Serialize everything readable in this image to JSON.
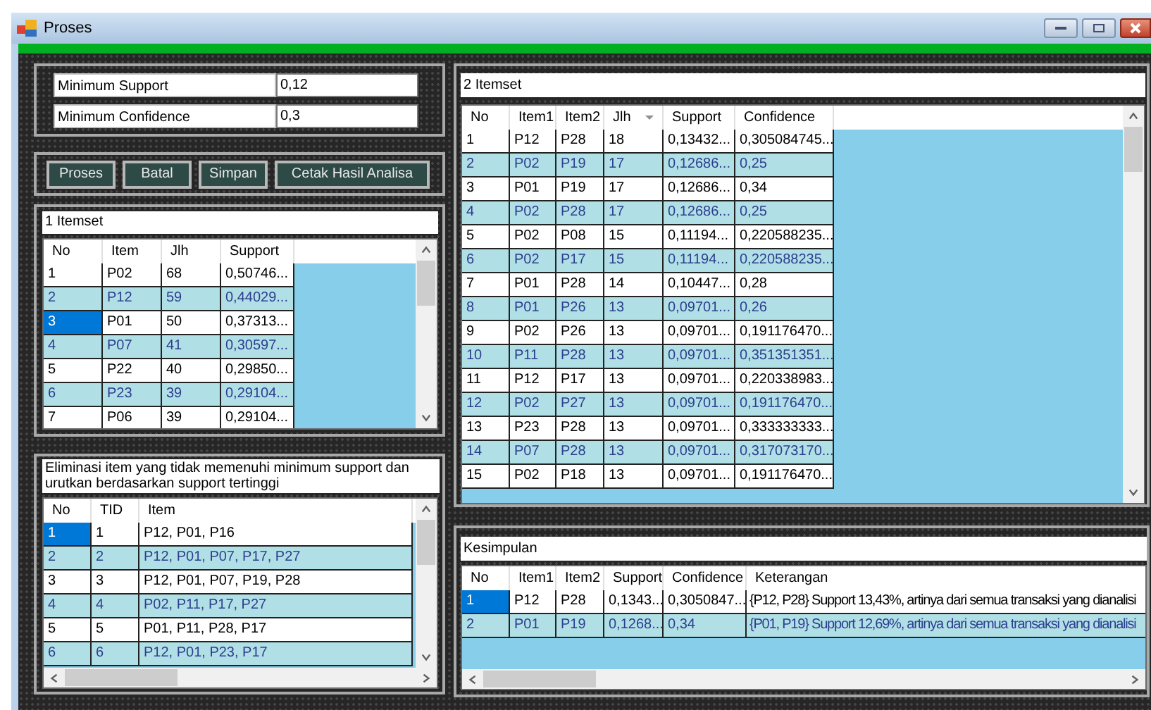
{
  "window": {
    "title": "Proses"
  },
  "parameters": [
    {
      "label": "Minimum Support",
      "value": "0,12"
    },
    {
      "label": "Minimum Confidence",
      "value": "0,3"
    }
  ],
  "buttons": [
    "Proses",
    "Batal",
    "Simpan",
    "Cetak Hasil Analisa"
  ],
  "itemset_1": {
    "title": "1 Itemset",
    "columns": [
      {
        "label": "No"
      },
      {
        "label": "Item"
      },
      {
        "label": "Jlh"
      },
      {
        "label": "Support"
      }
    ],
    "rows": [
      {
        "cells": [
          "1",
          "P02",
          "68",
          "0,50746..."
        ],
        "selected": false
      },
      {
        "cells": [
          "2",
          "P12",
          "59",
          "0,44029..."
        ],
        "selected": false
      },
      {
        "cells": [
          "3",
          "P01",
          "50",
          "0,37313..."
        ],
        "selected": true
      },
      {
        "cells": [
          "4",
          "P07",
          "41",
          "0,30597..."
        ],
        "selected": false
      },
      {
        "cells": [
          "5",
          "P22",
          "40",
          "0,29850..."
        ],
        "selected": false
      },
      {
        "cells": [
          "6",
          "P23",
          "39",
          "0,29104..."
        ],
        "selected": false
      },
      {
        "cells": [
          "7",
          "P06",
          "39",
          "0,29104..."
        ],
        "selected": false
      }
    ]
  },
  "elimination": {
    "title": "Eliminasi item yang tidak memenuhi minimum support dan urutkan berdasarkan support tertinggi",
    "columns": [
      {
        "label": "No"
      },
      {
        "label": "TID"
      },
      {
        "label": "Item"
      }
    ],
    "rows": [
      {
        "cells": [
          "1",
          "1",
          "P12, P01, P16"
        ],
        "selected": true
      },
      {
        "cells": [
          "2",
          "2",
          "P12, P01, P07, P17, P27"
        ],
        "selected": false
      },
      {
        "cells": [
          "3",
          "3",
          "P12, P01, P07, P19, P28"
        ],
        "selected": false
      },
      {
        "cells": [
          "4",
          "4",
          "P02, P11, P17, P27"
        ],
        "selected": false
      },
      {
        "cells": [
          "5",
          "5",
          "P01, P11, P28, P17"
        ],
        "selected": false
      },
      {
        "cells": [
          "6",
          "6",
          "P12, P01, P23, P17"
        ],
        "selected": false
      }
    ]
  },
  "itemset_2": {
    "title": "2 Itemset",
    "columns": [
      {
        "label": "No"
      },
      {
        "label": "Item1"
      },
      {
        "label": "Item2"
      },
      {
        "label": "Jlh",
        "sorted": true
      },
      {
        "label": "Support"
      },
      {
        "label": "Confidence"
      }
    ],
    "rows": [
      {
        "cells": [
          "1",
          "P12",
          "P28",
          "18",
          "0,13432...",
          "0,305084745..."
        ],
        "selected": false
      },
      {
        "cells": [
          "2",
          "P02",
          "P19",
          "17",
          "0,12686...",
          "0,25"
        ],
        "selected": false
      },
      {
        "cells": [
          "3",
          "P01",
          "P19",
          "17",
          "0,12686...",
          "0,34"
        ],
        "selected": false
      },
      {
        "cells": [
          "4",
          "P02",
          "P28",
          "17",
          "0,12686...",
          "0,25"
        ],
        "selected": false
      },
      {
        "cells": [
          "5",
          "P02",
          "P08",
          "15",
          "0,11194...",
          "0,220588235..."
        ],
        "selected": false
      },
      {
        "cells": [
          "6",
          "P02",
          "P17",
          "15",
          "0,11194...",
          "0,220588235..."
        ],
        "selected": false
      },
      {
        "cells": [
          "7",
          "P01",
          "P28",
          "14",
          "0,10447...",
          "0,28"
        ],
        "selected": false
      },
      {
        "cells": [
          "8",
          "P01",
          "P26",
          "13",
          "0,09701...",
          "0,26"
        ],
        "selected": false
      },
      {
        "cells": [
          "9",
          "P02",
          "P26",
          "13",
          "0,09701...",
          "0,191176470..."
        ],
        "selected": false
      },
      {
        "cells": [
          "10",
          "P11",
          "P28",
          "13",
          "0,09701...",
          "0,351351351..."
        ],
        "selected": false
      },
      {
        "cells": [
          "11",
          "P12",
          "P17",
          "13",
          "0,09701...",
          "0,220338983..."
        ],
        "selected": false
      },
      {
        "cells": [
          "12",
          "P02",
          "P27",
          "13",
          "0,09701...",
          "0,191176470..."
        ],
        "selected": false
      },
      {
        "cells": [
          "13",
          "P23",
          "P28",
          "13",
          "0,09701...",
          "0,333333333..."
        ],
        "selected": false
      },
      {
        "cells": [
          "14",
          "P07",
          "P28",
          "13",
          "0,09701...",
          "0,317073170..."
        ],
        "selected": false
      },
      {
        "cells": [
          "15",
          "P02",
          "P18",
          "13",
          "0,09701...",
          "0,191176470..."
        ],
        "selected": false
      }
    ]
  },
  "conclusion": {
    "title": "Kesimpulan",
    "columns": [
      {
        "label": "No"
      },
      {
        "label": "Item1"
      },
      {
        "label": "Item2"
      },
      {
        "label": "Support"
      },
      {
        "label": "Confidence"
      },
      {
        "label": "Keterangan"
      }
    ],
    "rows": [
      {
        "cells": [
          "1",
          "P12",
          "P28",
          "0,1343...",
          "0,3050847...",
          "{P12, P28} Support 13,43%, artinya dari semua transaksi yang dianalisi"
        ],
        "selected": true
      },
      {
        "cells": [
          "2",
          "P01",
          "P19",
          "0,1268...",
          "0,34",
          "{P01, P19} Support 12,69%, artinya dari semua transaksi yang dianalisi"
        ],
        "selected": false
      }
    ]
  }
}
